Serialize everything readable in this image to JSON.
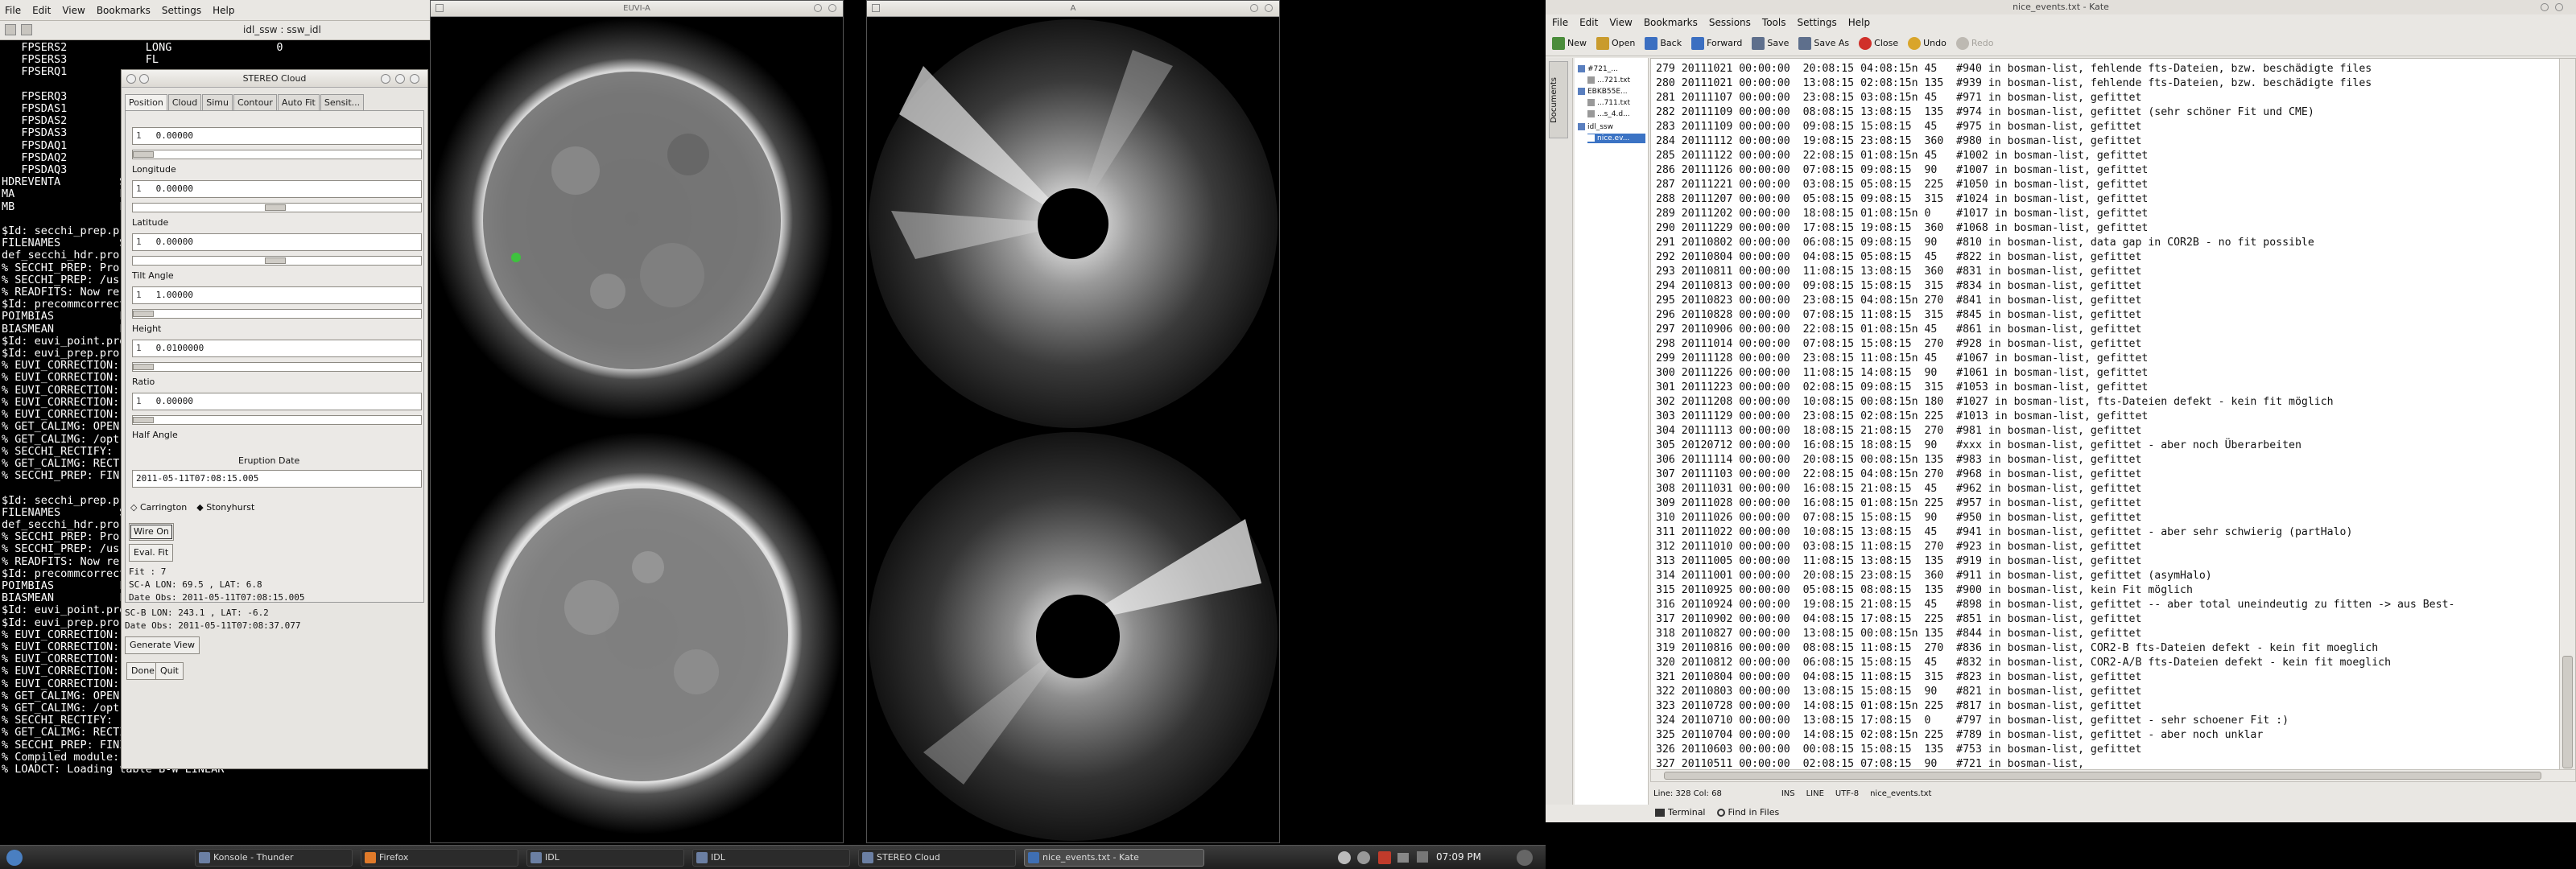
{
  "idl": {
    "menu": [
      "File",
      "Edit",
      "View",
      "Bookmarks",
      "Settings",
      "Help"
    ],
    "tab_title": "idl_ssw : ssw_idl",
    "console_lines": [
      "   FPSERS2            LONG                0",
      "   FPSERS3            FL",
      "   FPSERQ1",
      "",
      "   FPSERQ3",
      "   FPSDAS1",
      "   FPSDAS2",
      "   FPSDAS3",
      "   FPSDAQ1",
      "   FPSDAQ2",
      "   FPSDAQ3",
      "HDREVENTA         ST",
      "MA                FL",
      "MB                FL",
      "",
      "$Id: secchi_prep.pro",
      "FILENAMES         ST",
      "def_secchi_hdr.pro",
      "% SECCHI_PREP: Pro",
      "% SECCHI_PREP: /us",
      "% READFITS: Now re",
      "$Id: precommcorrect",
      "POIMBIAS          FL",
      "BIASMEAN          FL",
      "$Id: euvi_point.pro",
      "$Id: euvi_prep.pro",
      "% EUVI_CORRECTION:",
      "% EUVI_CORRECTION:",
      "% EUVI_CORRECTION:",
      "% EUVI_CORRECTION:",
      "% EUVI_CORRECTION:",
      "% GET_CALIMG: OPEN",
      "% GET_CALIMG: /opt",
      "% SECCHI_RECTIFY:",
      "% GET_CALIMG: RECT",
      "% SECCHI_PREP: FIN",
      "",
      "$Id: secchi_prep.pro",
      "FILENAMES         ST",
      "def_secchi_hdr.pro",
      "% SECCHI_PREP: Pro",
      "% SECCHI_PREP: /us",
      "% READFITS: Now re",
      "$Id: precommcorrect",
      "POIMBIAS          FL",
      "BIASMEAN          FL",
      "$Id: euvi_point.pro",
      "$Id: euvi_prep.pro",
      "% EUVI_CORRECTION:",
      "% EUVI_CORRECTION:",
      "% EUVI_CORRECTION:",
      "% EUVI_CORRECTION:",
      "% EUVI_CORRECTION:",
      "% GET_CALIMG: OPEN",
      "% GET_CALIMG: /opt",
      "% SECCHI_RECTIFY:",
      "% GET_CALIMG: RECTIFIED CALIBRATION IMAGE",
      "% SECCHI_PREP: FINISHED!",
      "% Compiled module: CMECLOUD.",
      "% LOADCT: Loading table B-W LINEAR"
    ]
  },
  "stereo": {
    "title": "STEREO Cloud",
    "tabs": [
      "Position",
      "Cloud",
      "Simu",
      "Contour",
      "Auto Fit",
      "Sensit..."
    ],
    "first_value": "0.00000",
    "fields": [
      {
        "label": "Longitude",
        "value": "0.00000"
      },
      {
        "label": "Latitude",
        "value": "0.00000"
      },
      {
        "label": "Tilt Angle",
        "value": "1.00000"
      },
      {
        "label": "Height",
        "value": "0.0100000"
      },
      {
        "label": "Ratio",
        "value": "0.00000"
      },
      {
        "label": "Half Angle",
        "value": ""
      }
    ],
    "field_prefix": "1",
    "eruption_label": "Eruption Date",
    "eruption_value": "2011-05-11T07:08:15.005",
    "radio_carrington": "Carrington",
    "radio_stonyhurst": "Stonyhurst",
    "btn_wire": "Wire On",
    "btn_eval": "Eval. Fit",
    "fit_line": "Fit : 7",
    "sc_a": "SC-A LON:   69.5 ,  LAT:    6.8",
    "date_a": "Date Obs: 2011-05-11T07:08:15.005",
    "sc_b": "SC-B LON:  243.1 ,  LAT:   -6.2",
    "date_b": "Date Obs: 2011-05-11T07:08:37.077",
    "btn_generate": "Generate View",
    "btn_done": "Done",
    "btn_quit": "Quit"
  },
  "windows": {
    "euvi_title": "EUVI-A",
    "cor_title": "A"
  },
  "taskbar": {
    "items": [
      "Konsole - Thunder",
      "Firefox",
      "IDL",
      "IDL",
      "STEREO Cloud",
      "Kate",
      "nice_events.txt - Kate"
    ],
    "clock": "07:09 PM"
  },
  "kate": {
    "title": "nice_events.txt - Kate",
    "menu": [
      "File",
      "Edit",
      "View",
      "Bookmarks",
      "Sessions",
      "Tools",
      "Settings",
      "Help"
    ],
    "toolbar": [
      {
        "label": "New",
        "color": "#4a8c3a"
      },
      {
        "label": "Open",
        "color": "#c99b2d"
      },
      {
        "label": "Back",
        "color": "#3b6fc1"
      },
      {
        "label": "Forward",
        "color": "#3b6fc1"
      },
      {
        "label": "Save",
        "color": "#5e6f8c"
      },
      {
        "label": "Save As",
        "color": "#5e6f8c"
      },
      {
        "label": "Close",
        "color": "#d0302a"
      },
      {
        "label": "Undo",
        "color": "#d9a52b"
      },
      {
        "label": "Redo",
        "color": "#bdb9b2"
      }
    ],
    "docs_tab": "Documents",
    "tree": [
      "#721_...",
      "...721.txt",
      "EBKB55E...",
      "...711.txt",
      "...s_4.d...",
      "idl_ssw",
      "nice.ev..."
    ],
    "lines": [
      "279 20111021 00:00:00  20:08:15 04:08:15n 45   #940 in bosman-list, fehlende fts-Dateien, bzw. beschädigte files",
      "280 20111021 00:00:00  13:08:15 02:08:15n 135  #939 in bosman-list, fehlende fts-Dateien, bzw. beschädigte files",
      "281 20111107 00:00:00  23:08:15 03:08:15n 45   #971 in bosman-list, gefittet",
      "282 20111109 00:00:00  08:08:15 13:08:15  135  #974 in bosman-list, gefittet (sehr schöner Fit und CME)",
      "283 20111109 00:00:00  09:08:15 15:08:15  45   #975 in bosman-list, gefittet",
      "284 20111112 00:00:00  19:08:15 23:08:15  360  #980 in bosman-list, gefittet",
      "285 20111122 00:00:00  22:08:15 01:08:15n 45   #1002 in bosman-list, gefittet",
      "286 20111126 00:00:00  07:08:15 09:08:15  90   #1007 in bosman-list, gefittet",
      "287 20111221 00:00:00  03:08:15 05:08:15  225  #1050 in bosman-list, gefittet",
      "288 20111207 00:00:00  05:08:15 09:08:15  315  #1024 in bosman-list, gefittet",
      "289 20111202 00:00:00  18:08:15 01:08:15n 0    #1017 in bosman-list, gefittet",
      "290 20111229 00:00:00  17:08:15 19:08:15  360  #1068 in bosman-list, gefittet",
      "291 20110802 00:00:00  06:08:15 09:08:15  90   #810 in bosman-list, data gap in COR2B - no fit possible",
      "292 20110804 00:00:00  04:08:15 05:08:15  45   #822 in bosman-list, gefittet",
      "293 20110811 00:00:00  11:08:15 13:08:15  360  #831 in bosman-list, gefittet",
      "294 20110813 00:00:00  09:08:15 15:08:15  315  #834 in bosman-list, gefittet",
      "295 20110823 00:00:00  23:08:15 04:08:15n 270  #841 in bosman-list, gefittet",
      "296 20110828 00:00:00  07:08:15 11:08:15  315  #845 in bosman-list, gefittet",
      "297 20110906 00:00:00  22:08:15 01:08:15n 45   #861 in bosman-list, gefittet",
      "298 20111014 00:00:00  07:08:15 15:08:15  270  #928 in bosman-list, gefittet",
      "299 20111128 00:00:00  23:08:15 11:08:15n 45   #1067 in bosman-list, gefittet",
      "300 20111226 00:00:00  11:08:15 14:08:15  90   #1061 in bosman-list, gefittet",
      "301 20111223 00:00:00  02:08:15 09:08:15  315  #1053 in bosman-list, gefittet",
      "302 20111208 00:00:00  10:08:15 00:08:15n 180  #1027 in bosman-list, fts-Dateien defekt - kein fit möglich",
      "303 20111129 00:00:00  23:08:15 02:08:15n 225  #1013 in bosman-list, gefittet",
      "304 20111113 00:00:00  18:08:15 21:08:15  270  #981 in bosman-list, gefittet",
      "305 20120712 00:00:00  16:08:15 18:08:15  90   #xxx in bosman-list, gefittet - aber noch Überarbeiten",
      "306 20111114 00:00:00  20:08:15 00:08:15n 135  #983 in bosman-list, gefittet",
      "307 20111103 00:00:00  22:08:15 04:08:15n 270  #968 in bosman-list, gefittet",
      "308 20111031 00:00:00  16:08:15 21:08:15  45   #962 in bosman-list, gefittet",
      "309 20111028 00:00:00  16:08:15 01:08:15n 225  #957 in bosman-list, gefittet",
      "310 20111026 00:00:00  07:08:15 15:08:15  90   #950 in bosman-list, gefittet",
      "311 20111022 00:00:00  10:08:15 13:08:15  45   #941 in bosman-list, gefittet - aber sehr schwierig (partHalo)",
      "312 20111010 00:00:00  03:08:15 11:08:15  270  #923 in bosman-list, gefittet",
      "313 20111005 00:00:00  11:08:15 13:08:15  135  #919 in bosman-list, gefittet",
      "314 20111001 00:00:00  20:08:15 23:08:15  360  #911 in bosman-list, gefittet (asymHalo)",
      "315 20110925 00:00:00  05:08:15 08:08:15  135  #900 in bosman-list, kein Fit möglich",
      "316 20110924 00:00:00  19:08:15 21:08:15  45   #898 in bosman-list, gefittet -- aber total uneindeutig zu fitten -> aus Best-",
      "317 20110902 00:00:00  04:08:15 17:08:15  225  #851 in bosman-list, gefittet",
      "318 20110827 00:00:00  13:08:15 00:08:15n 135  #844 in bosman-list, gefittet",
      "319 20110816 00:00:00  08:08:15 11:08:15  270  #836 in bosman-list, COR2-B fts-Dateien defekt - kein fit moeglich",
      "320 20110812 00:00:00  06:08:15 15:08:15  45   #832 in bosman-list, COR2-A/B fts-Dateien defekt - kein fit moeglich",
      "321 20110804 00:00:00  04:08:15 11:08:15  315  #823 in bosman-list, gefittet",
      "322 20110803 00:00:00  13:08:15 15:08:15  90   #821 in bosman-list, gefittet",
      "323 20110728 00:00:00  14:08:15 01:08:15n 225  #817 in bosman-list, gefittet",
      "324 20110710 00:00:00  13:08:15 17:08:15  0    #797 in bosman-list, gefittet - sehr schoener Fit :)",
      "325 20110704 00:00:00  14:08:15 02:08:15n 225  #789 in bosman-list, gefittet - aber noch unklar",
      "326 20110603 00:00:00  00:08:15 15:08:15  135  #753 in bosman-list, gefittet",
      "327 20110511 00:00:00  02:08:15 07:08:15  90   #721 in bosman-list,"
    ],
    "status": [
      "Line: 328 Col: 68",
      "INS",
      "LINE",
      "UTF-8",
      "nice_events.txt"
    ],
    "bottom": [
      "Terminal",
      "Find in Files"
    ]
  }
}
